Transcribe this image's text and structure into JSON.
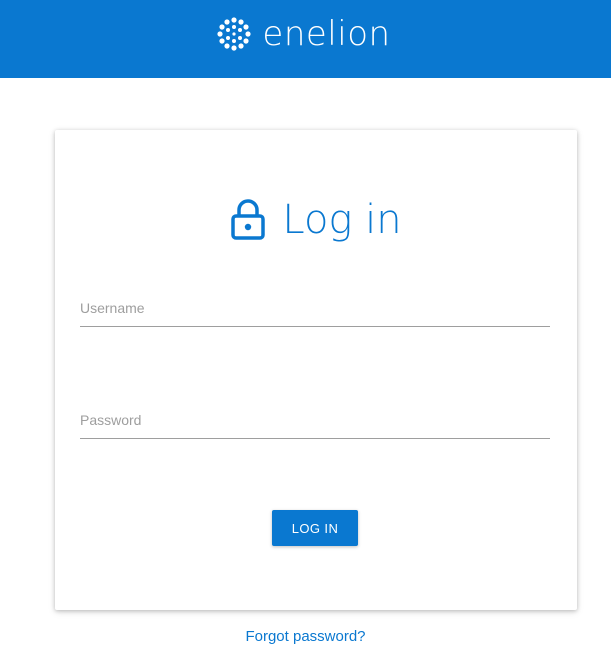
{
  "header": {
    "brand_name": "enelion",
    "logo_icon": "enelion-logo-icon"
  },
  "login_card": {
    "title": "Log in",
    "title_icon": "lock-icon",
    "username": {
      "placeholder": "Username",
      "value": ""
    },
    "password": {
      "placeholder": "Password",
      "value": ""
    },
    "submit_label": "LOG IN"
  },
  "forgot_password_label": "Forgot password?",
  "colors": {
    "brand_blue": "#0a78d0",
    "header_text": "#ffffff",
    "placeholder_gray": "#9e9e9e"
  }
}
